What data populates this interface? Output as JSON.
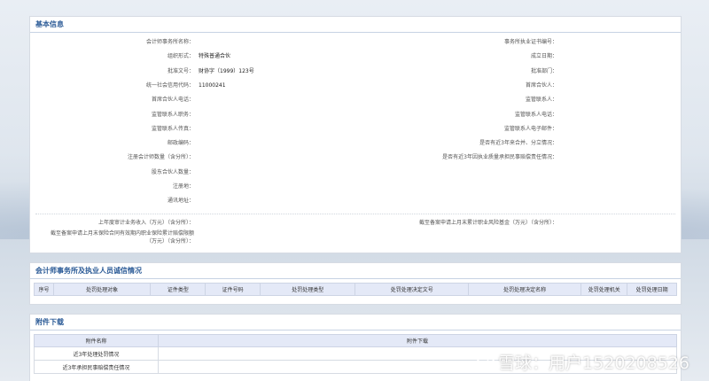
{
  "basic": {
    "title": "基本信息",
    "left": [
      {
        "label": "会计师事务所名称：",
        "value": ""
      },
      {
        "label": "组织形式：",
        "value": "特殊普通合伙"
      },
      {
        "label": "批准文号：",
        "value": "财协字（1999）123号"
      },
      {
        "label": "统一社会信用代码：",
        "value": "11000241"
      },
      {
        "label": "首席合伙人电话：",
        "value": ""
      },
      {
        "label": "监管联系人职务：",
        "value": ""
      },
      {
        "label": "监管联系人传真：",
        "value": ""
      },
      {
        "label": "邮政编码：",
        "value": ""
      },
      {
        "label": "注册会计师数量（含分所）：",
        "value": ""
      },
      {
        "label": "股东合伙人数量：",
        "value": ""
      },
      {
        "label": "注册地：",
        "value": ""
      },
      {
        "label": "通讯地址：",
        "value": ""
      }
    ],
    "right": [
      {
        "label": "事务所执业证书编号：",
        "value": ""
      },
      {
        "label": "成立日期：",
        "value": ""
      },
      {
        "label": "批准部门：",
        "value": ""
      },
      {
        "label": "首席合伙人：",
        "value": ""
      },
      {
        "label": "监管联系人：",
        "value": ""
      },
      {
        "label": "监管联系人电话：",
        "value": ""
      },
      {
        "label": "监管联系人电子邮件：",
        "value": ""
      },
      {
        "label": "是否有近3年来合并、分立情况：",
        "value": ""
      },
      {
        "label": "是否有近3年因执业质量承担民事赔偿责任情况：",
        "value": ""
      }
    ],
    "extra_left_1": "上年度审计业务收入（万元）（含分所）：",
    "extra_left_2a": "截至备案申请上月末保险合同有效期内职业保险累计赔偿限额",
    "extra_left_2b": "（万元）（含分所）：",
    "extra_right_1": "截至备案申请上月末累计职业风险基金（万元）（含分所）："
  },
  "integrity": {
    "title": "会计师事务所及执业人员诚信情况",
    "columns": [
      "序号",
      "处罚处理对象",
      "证件类型",
      "证件号码",
      "处罚处理类型",
      "处罚处理决定文号",
      "处罚处理决定名称",
      "处罚处理机关",
      "处罚处理日期"
    ]
  },
  "attach": {
    "title": "附件下载",
    "columns": [
      "附件名称",
      "附件下载"
    ],
    "rows": [
      {
        "name": "近3年处理处罚情况",
        "download": ""
      },
      {
        "name": "近3年承担民事赔偿责任情况",
        "download": ""
      }
    ]
  },
  "watermark": {
    "text": "雪球：用户1520208526"
  }
}
